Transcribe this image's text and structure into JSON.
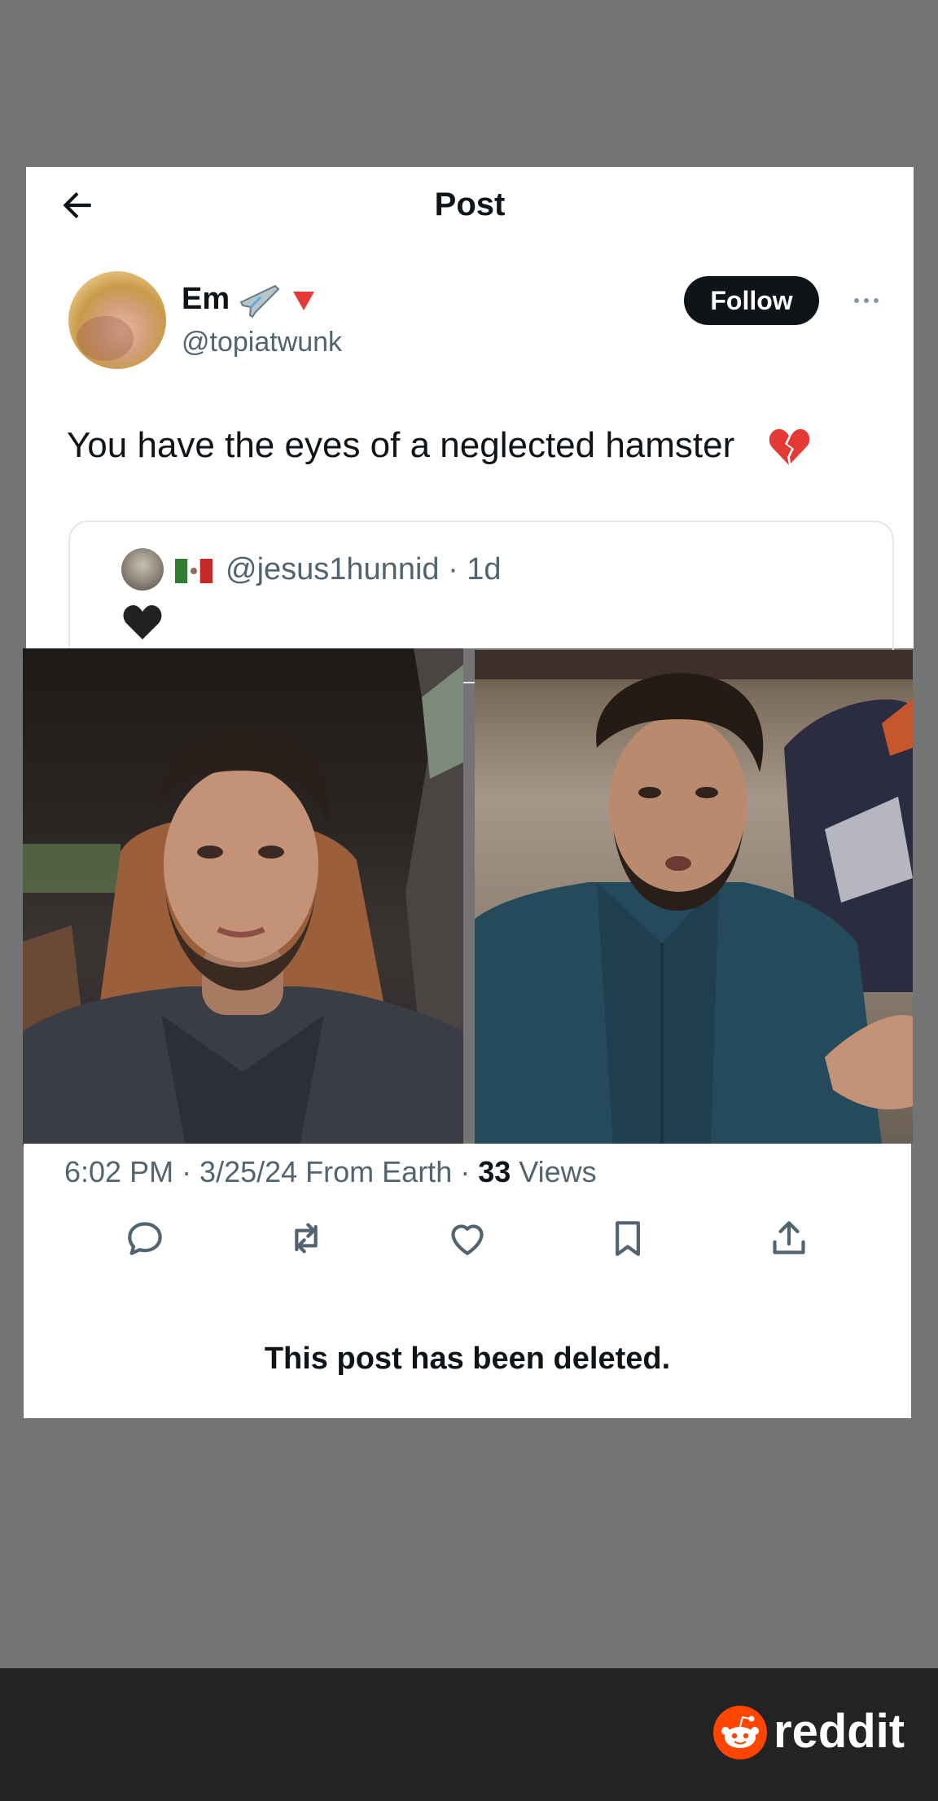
{
  "header": {
    "title": "Post"
  },
  "author": {
    "display_name": "Em",
    "handle": "@topiatwunk",
    "follow_label": "Follow"
  },
  "post": {
    "text": "You have the eyes of a neglected hamster"
  },
  "quoted_post": {
    "meta": "@jesus1hunnid · 1d"
  },
  "stats": {
    "timestamp": "6:02 PM · 3/25/24 From Earth · ",
    "views_count": "33",
    "views_label": " Views"
  },
  "actions": [
    "reply-icon",
    "repost-icon",
    "like-icon",
    "bookmark-icon",
    "share-icon"
  ],
  "notice": "This post has been deleted.",
  "footer": {
    "brand": "reddit",
    "brand_color": "#ff4500"
  },
  "colors": {
    "background": "#747474",
    "card": "#ffffff",
    "muted_text": "#536471",
    "follow_button": "#0f1419"
  }
}
